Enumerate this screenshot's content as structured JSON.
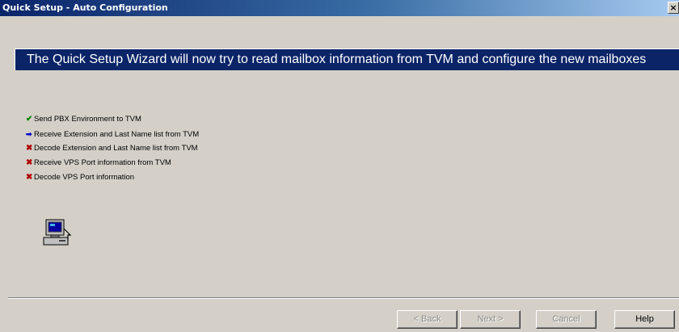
{
  "window": {
    "title": "Quick Setup - Auto Configuration",
    "close_glyph": "×"
  },
  "banner": {
    "text": "The Quick Setup Wizard will now try to read mailbox information from TVM and configure the new mailboxes"
  },
  "steps": [
    {
      "status": "done",
      "icon": "check-icon",
      "glyph": "✔",
      "label": "Send PBX Environment to TVM"
    },
    {
      "status": "in-progress",
      "icon": "arrow-icon",
      "glyph": "➡",
      "label": "Receive Extension and Last Name list from TVM"
    },
    {
      "status": "pending",
      "icon": "x-icon",
      "glyph": "✖",
      "label": "Decode Extension and Last Name list from TVM"
    },
    {
      "status": "pending",
      "icon": "x-icon",
      "glyph": "✖",
      "label": "Receive VPS Port information from TVM"
    },
    {
      "status": "pending",
      "icon": "x-icon",
      "glyph": "✖",
      "label": "Decode VPS Port information"
    }
  ],
  "buttons": {
    "back": {
      "label": "< Back",
      "enabled": false
    },
    "next": {
      "label": "Next >",
      "enabled": false
    },
    "cancel": {
      "label": "Cancel",
      "enabled": false
    },
    "help": {
      "label": "Help",
      "enabled": true
    }
  },
  "icons": {
    "computer": "computer-icon"
  }
}
